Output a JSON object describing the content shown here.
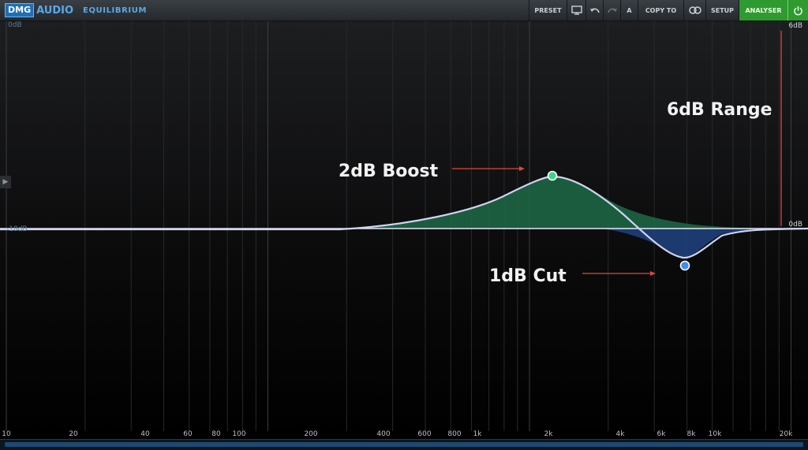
{
  "app": {
    "brand": "DMG",
    "brand2": "AUDIO",
    "product": "EQUILIBRIUM"
  },
  "toolbar": {
    "preset": "PRESET",
    "a_label": "A",
    "copy_to": "COPY TO",
    "setup": "SETUP",
    "analyser": "ANALYSER"
  },
  "graph": {
    "top_left_db": "0dB",
    "top_right_db": "6dB",
    "mid_left_db": "-18dB",
    "bottom_right_db": "0dB",
    "freq_labels": [
      "10",
      "20",
      "40",
      "60",
      "80",
      "100",
      "200",
      "400",
      "600",
      "800",
      "1k",
      "2k",
      "4k",
      "6k",
      "8k",
      "10k",
      "20k"
    ]
  },
  "annotations": {
    "boost": "2dB Boost",
    "cut": "1dB Cut",
    "range": "6dB Range"
  },
  "colors": {
    "boost_fill": "#1f6a46",
    "cut_fill": "#1e3f7a",
    "curve": "#cfd4f0",
    "boost_node": "#3fd38a",
    "cut_node": "#3f8fe8",
    "annotation_arrow": "#e0473a",
    "analyser_active": "#2f9a2f"
  }
}
